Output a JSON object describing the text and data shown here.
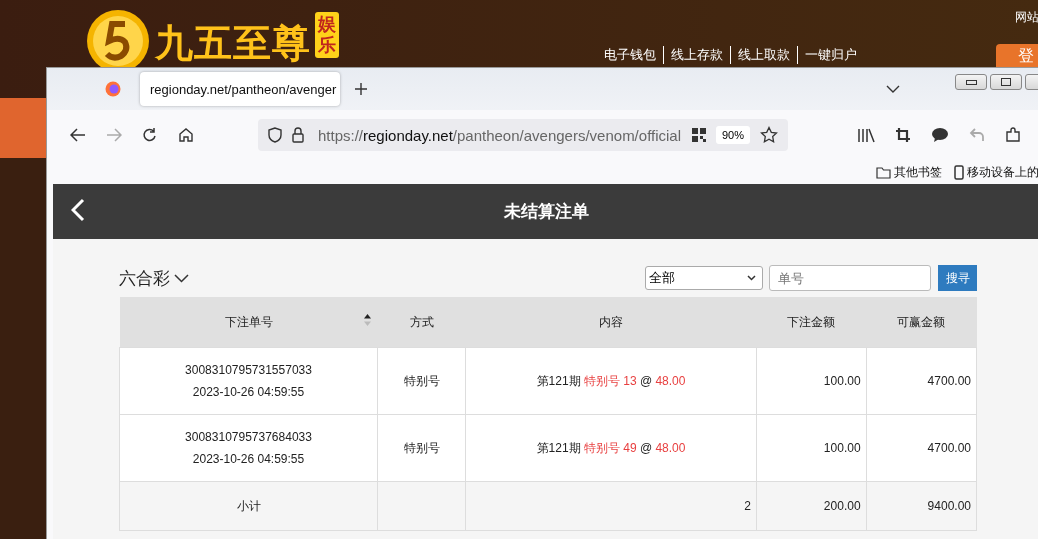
{
  "background_site": {
    "logo_text": "九五至尊",
    "logo_badge": "娱乐",
    "nav_links": [
      "电子钱包",
      "线上存款",
      "线上取款",
      "一键归户"
    ],
    "top_right_text": "网站",
    "login_button": "登"
  },
  "browser": {
    "tabs": [
      {
        "title": "regionday.net/pantheon/avenger",
        "selected": true
      }
    ],
    "url_prefix": "https://",
    "url_domain": "regionday.net",
    "url_path": "/pantheon/avengers/venom/official",
    "zoom": "90%",
    "bookmarks": [
      "其他书签",
      "移动设备上的"
    ]
  },
  "page": {
    "title": "未结算注单",
    "lottery": "六合彩",
    "filter": "全部",
    "search": {
      "placeholder": "单号"
    },
    "search_button": "搜寻",
    "table": {
      "columns": [
        "下注单号",
        "方式",
        "内容",
        "下注金额",
        "可赢金额"
      ],
      "rows": [
        {
          "order_no": "3008310795731557033",
          "time": "2023-10-26 04:59:55",
          "method": "特别号",
          "period": "第121期",
          "bet": "特别号 13",
          "at": "@",
          "odds": "48.00",
          "amount": "100.00",
          "win": "4700.00"
        },
        {
          "order_no": "3008310795737684033",
          "time": "2023-10-26 04:59:55",
          "method": "特别号",
          "period": "第121期",
          "bet": "特别号 49",
          "at": "@",
          "odds": "48.00",
          "amount": "100.00",
          "win": "4700.00"
        }
      ],
      "subtotal": {
        "label": "小计",
        "count": "2",
        "amount": "200.00",
        "win": "9400.00"
      }
    }
  }
}
